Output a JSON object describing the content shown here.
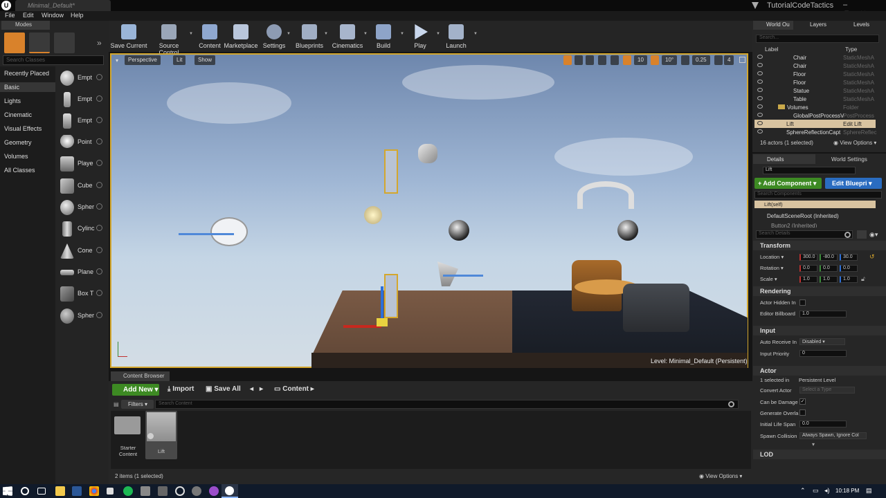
{
  "window": {
    "tab_title": "Minimal_Default*",
    "user": "TutorialCodeTactics",
    "logo": "U"
  },
  "menu": [
    "File",
    "Edit",
    "Window",
    "Help"
  ],
  "modes": {
    "tab": "Modes",
    "search_placeholder": "Search Classes",
    "categories": [
      "Recently Placed",
      "Basic",
      "Lights",
      "Cinematic",
      "Visual Effects",
      "Geometry",
      "Volumes",
      "All Classes"
    ],
    "selected_category": "Basic",
    "items": [
      "Empt",
      "Empt",
      "Empt",
      "Point",
      "Playe",
      "Cube",
      "Spher",
      "Cylinc",
      "Cone",
      "Plane",
      "Box T",
      "Spher"
    ]
  },
  "toolbar": [
    "Save Current",
    "Source Control",
    "Content",
    "Marketplace",
    "Settings",
    "Blueprints",
    "Cinematics",
    "Build",
    "Play",
    "Launch"
  ],
  "viewport": {
    "view_mode": "Perspective",
    "lighting": "Lit",
    "show": "Show",
    "snap_grid": "10",
    "snap_rot": "10°",
    "snap_scale": "0.25",
    "camera_speed": "4",
    "level_label": "Level:",
    "level_name": "Minimal_Default (Persistent)"
  },
  "outliner": {
    "tabs": [
      "World Ou",
      "Layers",
      "Levels"
    ],
    "search_placeholder": "Search...",
    "col_label": "Label",
    "col_type": "Type",
    "rows": [
      {
        "label": "Chair",
        "type": "StaticMeshA"
      },
      {
        "label": "Chair",
        "type": "StaticMeshA"
      },
      {
        "label": "Floor",
        "type": "StaticMeshA"
      },
      {
        "label": "Floor",
        "type": "StaticMeshA"
      },
      {
        "label": "Statue",
        "type": "StaticMeshA"
      },
      {
        "label": "Table",
        "type": "StaticMeshA"
      },
      {
        "label": "Volumes",
        "type": "Folder"
      },
      {
        "label": "GlobalPostProcessV",
        "type": "PostProcess"
      },
      {
        "label": "Lift",
        "type": "Edit Lift"
      },
      {
        "label": "SphereReflectionCapt",
        "type": "SphereReflec"
      }
    ],
    "summary": "16 actors (1 selected)",
    "view_options": "View Options"
  },
  "details": {
    "tabs": [
      "Details",
      "World Settings"
    ],
    "actor_name": "Lift",
    "add_component": "+ Add Component",
    "edit_blueprint": "Edit Bluepri",
    "components_search": "Search Components",
    "components": [
      "Lift(self)",
      "DefaultSceneRoot (Inherited)",
      "Button2 (Inherited)"
    ],
    "search_placeholder": "Search Details",
    "transform": {
      "title": "Transform",
      "location_label": "Location",
      "location": [
        "300.0",
        "-80.0",
        "30.0"
      ],
      "rotation_label": "Rotation",
      "rotation": [
        "0.0",
        "0.0",
        "0.0"
      ],
      "scale_label": "Scale",
      "scale": [
        "1.0",
        "1.0",
        "1.0"
      ]
    },
    "rendering": {
      "title": "Rendering",
      "hidden_label": "Actor Hidden In",
      "billboard_label": "Editor Billboard",
      "billboard_value": "1.0"
    },
    "input": {
      "title": "Input",
      "auto_label": "Auto Receive In",
      "auto_value": "Disabled",
      "priority_label": "Input Priority",
      "priority_value": "0"
    },
    "actor": {
      "title": "Actor",
      "selected_label": "1 selected in",
      "selected_value": "Persistent Level",
      "convert_label": "Convert Actor",
      "convert_value": "Select a Type",
      "damage_label": "Can be Damage",
      "overlap_label": "Generate Overla",
      "lifespan_label": "Initial Life Span",
      "lifespan_value": "0.0",
      "spawn_label": "Spawn Collision",
      "spawn_value": "Always Spawn, Ignore Col"
    },
    "lod": "LOD"
  },
  "content_browser": {
    "tab": "Content Browser",
    "add_new": "Add New",
    "import": "Import",
    "save_all": "Save All",
    "path": "Content",
    "filters": "Filters",
    "search_placeholder": "Search Content",
    "assets": [
      {
        "label": "Starter Content"
      },
      {
        "label": "Lift"
      }
    ],
    "summary": "2 items (1 selected)",
    "view_options": "View Options"
  },
  "taskbar": {
    "time": "10:18 PM"
  }
}
